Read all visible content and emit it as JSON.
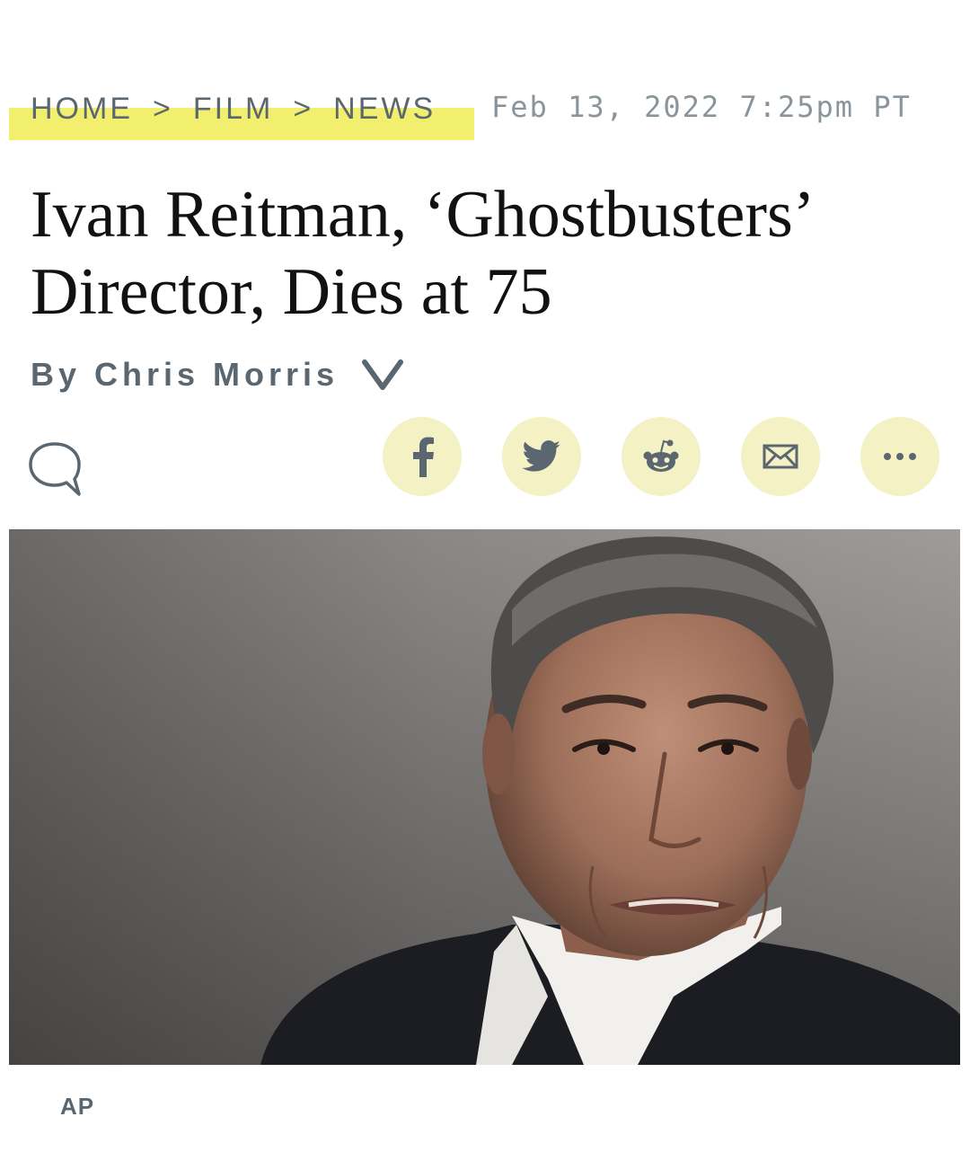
{
  "breadcrumb": {
    "items": [
      "HOME",
      "FILM",
      "NEWS"
    ],
    "separator": ">",
    "highlight_color": "#f2ef6e"
  },
  "article": {
    "timestamp": "Feb 13, 2022 7:25pm PT",
    "headline_line1": "Ivan Reitman, ‘Ghostbusters’",
    "headline_line2": "Director, Dies at 75",
    "byline": "By Chris Morris",
    "photo_credit": "AP"
  },
  "actions": {
    "comment_icon": "comment-bubble-icon",
    "share_buttons": [
      {
        "icon": "facebook-icon"
      },
      {
        "icon": "twitter-icon"
      },
      {
        "icon": "reddit-icon"
      },
      {
        "icon": "email-icon"
      },
      {
        "icon": "more-icon"
      }
    ],
    "share_button_color": "#f4f1c5",
    "icon_color": "#5b6770"
  }
}
